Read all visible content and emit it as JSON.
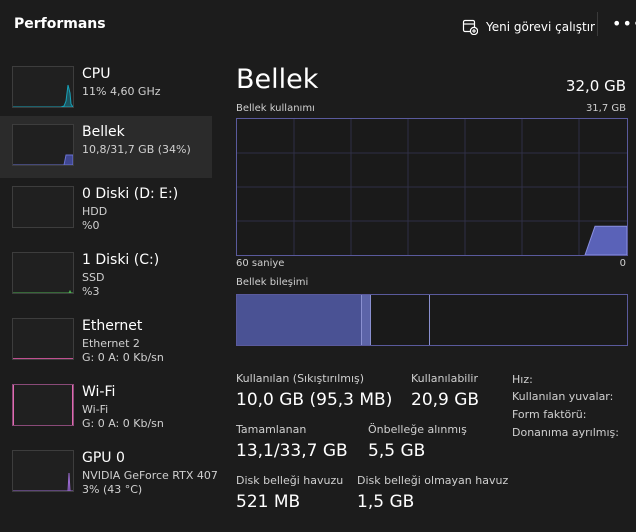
{
  "header": {
    "title": "Performans",
    "run_task_label": "Yeni görevi çalıştır",
    "more_label": "•••"
  },
  "sidebar": {
    "items": [
      {
        "name": "CPU",
        "line1": "11% 4,60 GHz",
        "line2": "",
        "color": "#17a2b8"
      },
      {
        "name": "Bellek",
        "line1": "10,8/31,7 GB (34%)",
        "line2": "",
        "color": "#6a72d0"
      },
      {
        "name": "0 Diski (D: E:)",
        "line1": "HDD",
        "line2": "%0",
        "color": "#4caf50"
      },
      {
        "name": "1 Diski (C:)",
        "line1": "SSD",
        "line2": "%3",
        "color": "#4caf50"
      },
      {
        "name": "Ethernet",
        "line1": "Ethernet 2",
        "line2": "G: 0 A: 0 Kb/sn",
        "color": "#c05090"
      },
      {
        "name": "Wi-Fi",
        "line1": "Wi-Fi",
        "line2": "G: 0 A: 0 Kb/sn",
        "color": "#e06ab0"
      },
      {
        "name": "GPU 0",
        "line1": "NVIDIA GeForce RTX 407",
        "line2": "3% (43 °C)",
        "color": "#9a6ad0"
      }
    ]
  },
  "memory": {
    "title": "Bellek",
    "total": "32,0 GB",
    "usage_label": "Bellek kullanımı",
    "usage_max": "31,7 GB",
    "axis_left": "60 saniye",
    "axis_right": "0",
    "composition_label": "Bellek bileşimi",
    "usage_fraction": 0.34,
    "stats": {
      "in_use_label": "Kullanılan (Sıkıştırılmış)",
      "in_use_value": "10,0 GB (95,3 MB)",
      "available_label": "Kullanılabilir",
      "available_value": "20,9 GB",
      "committed_label": "Tamamlanan",
      "committed_value": "13,1/33,7 GB",
      "cached_label": "Önbelleğe alınmış",
      "cached_value": "5,5 GB",
      "paged_label": "Disk belleği havuzu",
      "paged_value": "521 MB",
      "nonpaged_label": "Disk belleği olmayan havuz",
      "nonpaged_value": "1,5 GB",
      "speed_label": "Hız:",
      "slots_label": "Kullanılan yuvalar:",
      "form_label": "Form faktörü:",
      "reserved_label": "Donanıma ayrılmış:"
    }
  }
}
